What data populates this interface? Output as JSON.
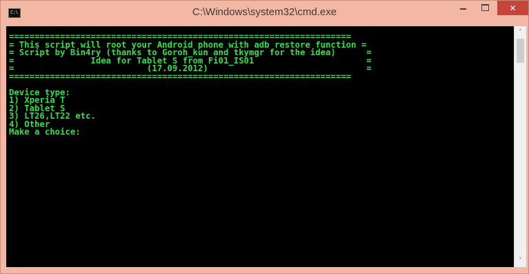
{
  "window": {
    "title": "C:\\Windows\\system32\\cmd.exe",
    "app_icon_text": "C:\\",
    "controls": {
      "minimize": "minimize-icon",
      "maximize": "maximize-icon",
      "close": "✕"
    }
  },
  "console": {
    "text": "===================================================================\n= This script will root your Android phone with adb restore function =\n= Script by Bin4ry (thanks to Goroh_kun and tkymgr for the idea)      =\n=               Idea for Tablet S from Fi01_IS01                      =\n=                          (17.09.2012)                               =\n===================================================================\n\nDevice type:\n1) Xperia T\n2) Tablet S\n3) LT26,LT22 etc.\n4) Other\nMake a choice:"
  },
  "scrollbar": {
    "up": "˄",
    "down": "˅"
  },
  "colors": {
    "titlebar": "#f2b8a4",
    "close_button": "#c7443a",
    "console_bg": "#000000",
    "console_text": "#2fe04a"
  }
}
